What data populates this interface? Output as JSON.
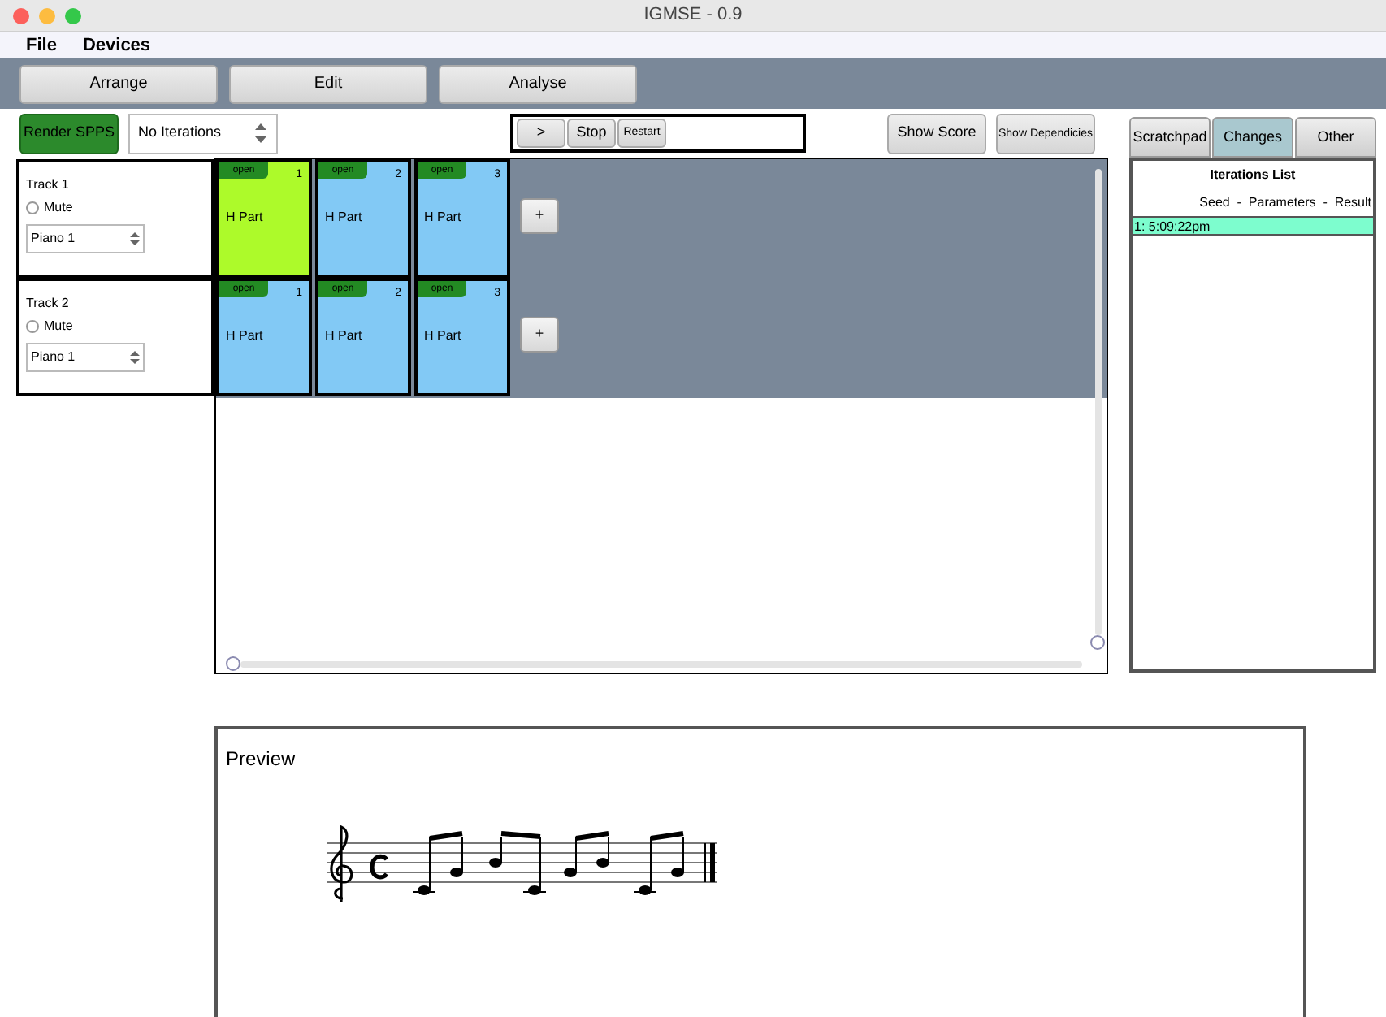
{
  "window": {
    "title": "IGMSE - 0.9"
  },
  "menu": [
    "File",
    "Devices"
  ],
  "mode_buttons": [
    "Arrange",
    "Edit",
    "Analyse"
  ],
  "render_button": "Render SPPS",
  "iterations_select": {
    "value": "No Iterations"
  },
  "transport": [
    ">",
    "Stop",
    "Restart"
  ],
  "show_score": "Show Score",
  "show_dependencies": "Show Dependicies",
  "tracks": [
    {
      "name": "Track 1",
      "mute_label": "Mute",
      "muted": false,
      "instrument": "Piano 1",
      "add": "+",
      "parts": [
        {
          "open": "open",
          "number": "1",
          "label": "H Part",
          "selected": true
        },
        {
          "open": "open",
          "number": "2",
          "label": "H Part",
          "selected": false
        },
        {
          "open": "open",
          "number": "3",
          "label": "H Part",
          "selected": false
        }
      ]
    },
    {
      "name": "Track 2",
      "mute_label": "Mute",
      "muted": false,
      "instrument": "Piano 1",
      "add": "+",
      "parts": [
        {
          "open": "open",
          "number": "1",
          "label": "H Part",
          "selected": false
        },
        {
          "open": "open",
          "number": "2",
          "label": "H Part",
          "selected": false
        },
        {
          "open": "open",
          "number": "3",
          "label": "H Part",
          "selected": false
        }
      ]
    }
  ],
  "side_tabs": [
    {
      "label": "Scratchpad",
      "selected": false
    },
    {
      "label": "Changes",
      "selected": true
    },
    {
      "label": "Other",
      "selected": false
    }
  ],
  "iterations_list": {
    "title": "Iterations List",
    "header": "Seed  -  Parameters  -  Result",
    "items": [
      {
        "label": "1: 5:09:22pm",
        "selected": true
      }
    ]
  },
  "preview": {
    "title": "Preview"
  }
}
